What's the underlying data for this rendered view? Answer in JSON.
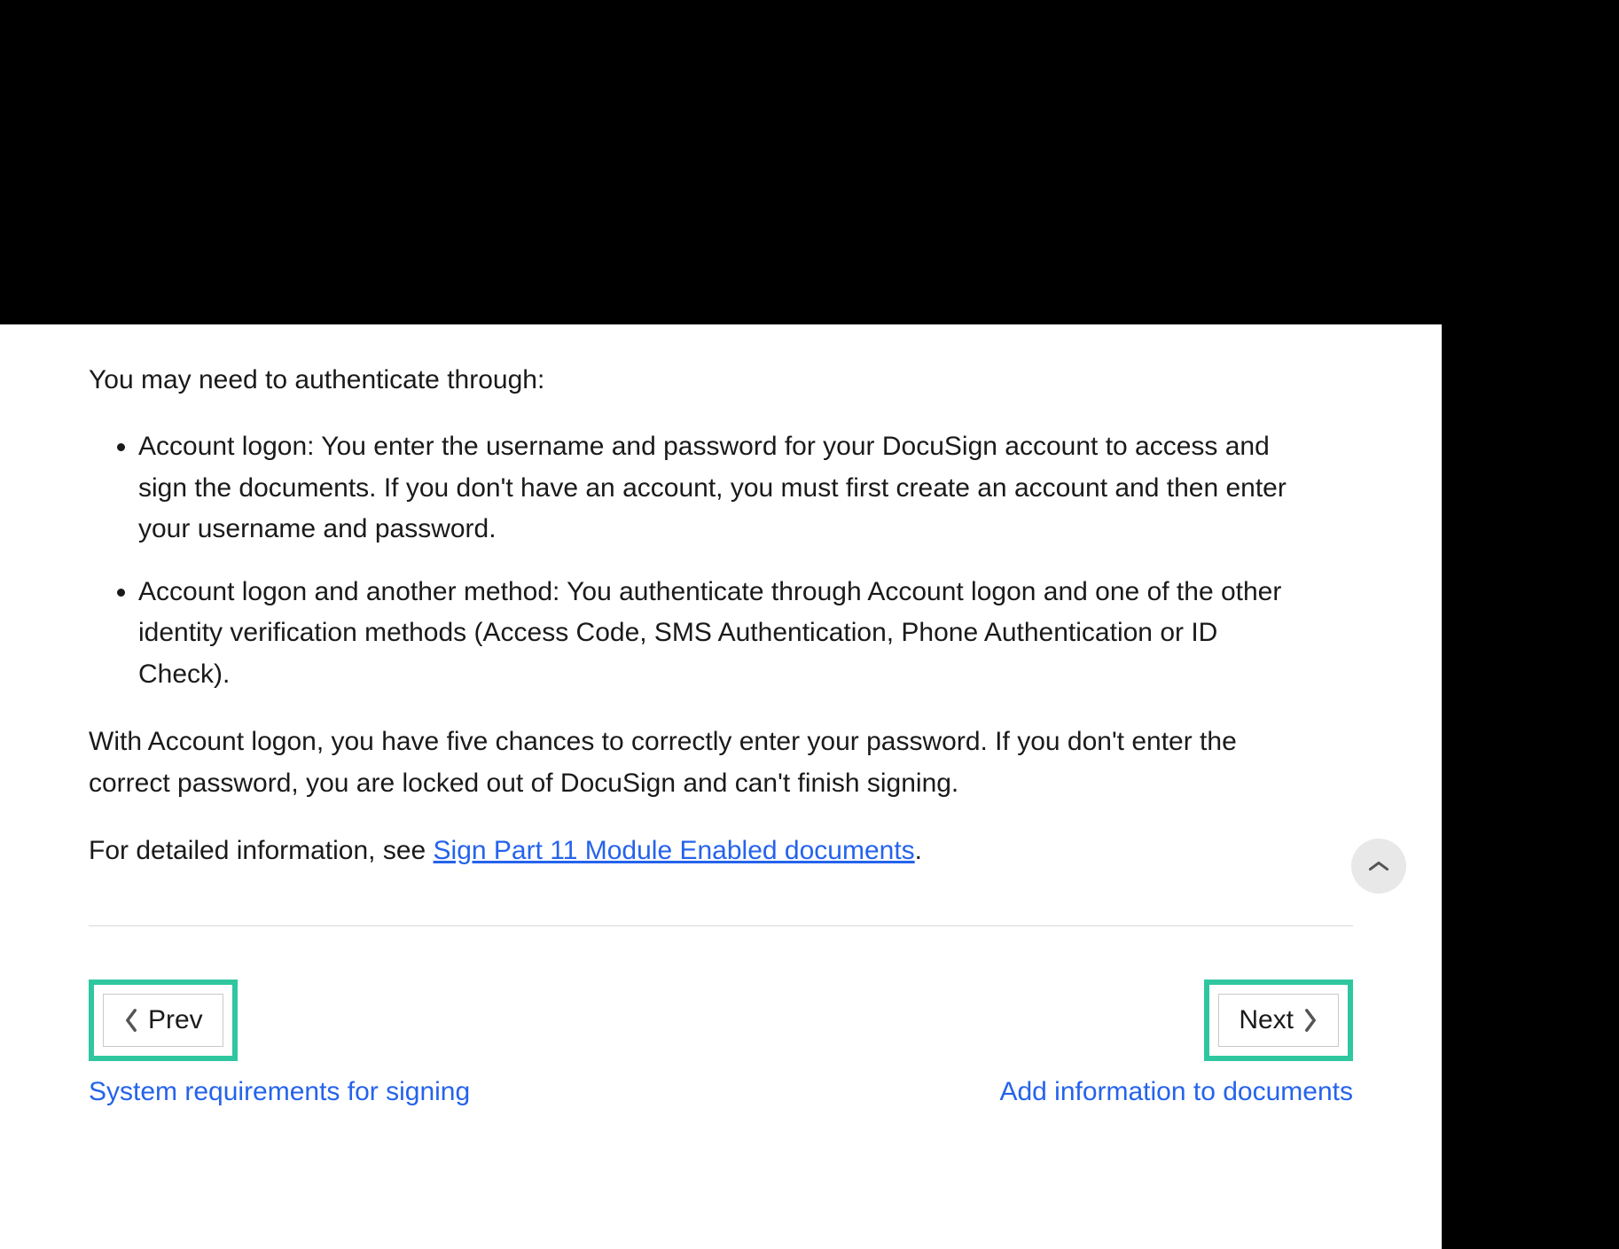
{
  "content": {
    "intro": "You may need to authenticate through:",
    "bullets": [
      "Account logon: You enter the username and password for your DocuSign account to access and sign the documents. If you don't have an account, you must first create an account and then enter your username and password.",
      "Account logon and another method: You authenticate through Account logon and one of the other identity verification methods (Access Code, SMS Authentication, Phone Authentication or ID Check)."
    ],
    "lockout": "With Account logon, you have five chances to correctly enter your password. If you don't enter the correct password, you are locked out of DocuSign and can't finish signing.",
    "detail_prefix": "For detailed information, see ",
    "detail_link": "Sign Part 11 Module Enabled documents",
    "detail_suffix": "."
  },
  "nav": {
    "prev_label": "Prev",
    "prev_sub": "System requirements for signing",
    "next_label": "Next",
    "next_sub": "Add information to documents"
  },
  "colors": {
    "link": "#2563eb",
    "highlight": "#2fc79f"
  }
}
